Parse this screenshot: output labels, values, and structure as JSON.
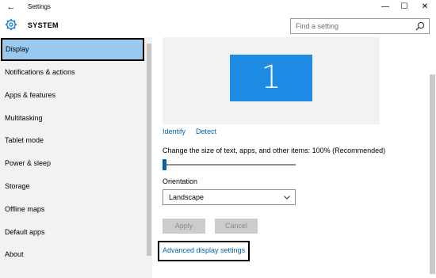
{
  "window": {
    "title": "Settings",
    "back_glyph": "←",
    "min_glyph": "—",
    "max_glyph": "☐",
    "close_glyph": "✕"
  },
  "header": {
    "section_title": "SYSTEM",
    "search_placeholder": "Find a setting"
  },
  "sidebar": {
    "items": [
      {
        "label": "Display",
        "active": true
      },
      {
        "label": "Notifications & actions",
        "active": false
      },
      {
        "label": "Apps & features",
        "active": false
      },
      {
        "label": "Multitasking",
        "active": false
      },
      {
        "label": "Tablet mode",
        "active": false
      },
      {
        "label": "Power & sleep",
        "active": false
      },
      {
        "label": "Storage",
        "active": false
      },
      {
        "label": "Offline maps",
        "active": false
      },
      {
        "label": "Default apps",
        "active": false
      },
      {
        "label": "About",
        "active": false
      }
    ]
  },
  "display": {
    "monitor_number": "1",
    "identify_label": "Identify",
    "detect_label": "Detect",
    "scale_label": "Change the size of text, apps, and other items: 100% (Recommended)",
    "scale_slider_fraction": 0.0,
    "orientation_label": "Orientation",
    "orientation_value": "Landscape",
    "apply_label": "Apply",
    "cancel_label": "Cancel",
    "advanced_link": "Advanced display settings"
  },
  "colors": {
    "accent": "#0063b1",
    "monitor": "#1e8be5",
    "selected_item": "#99c9ef"
  }
}
